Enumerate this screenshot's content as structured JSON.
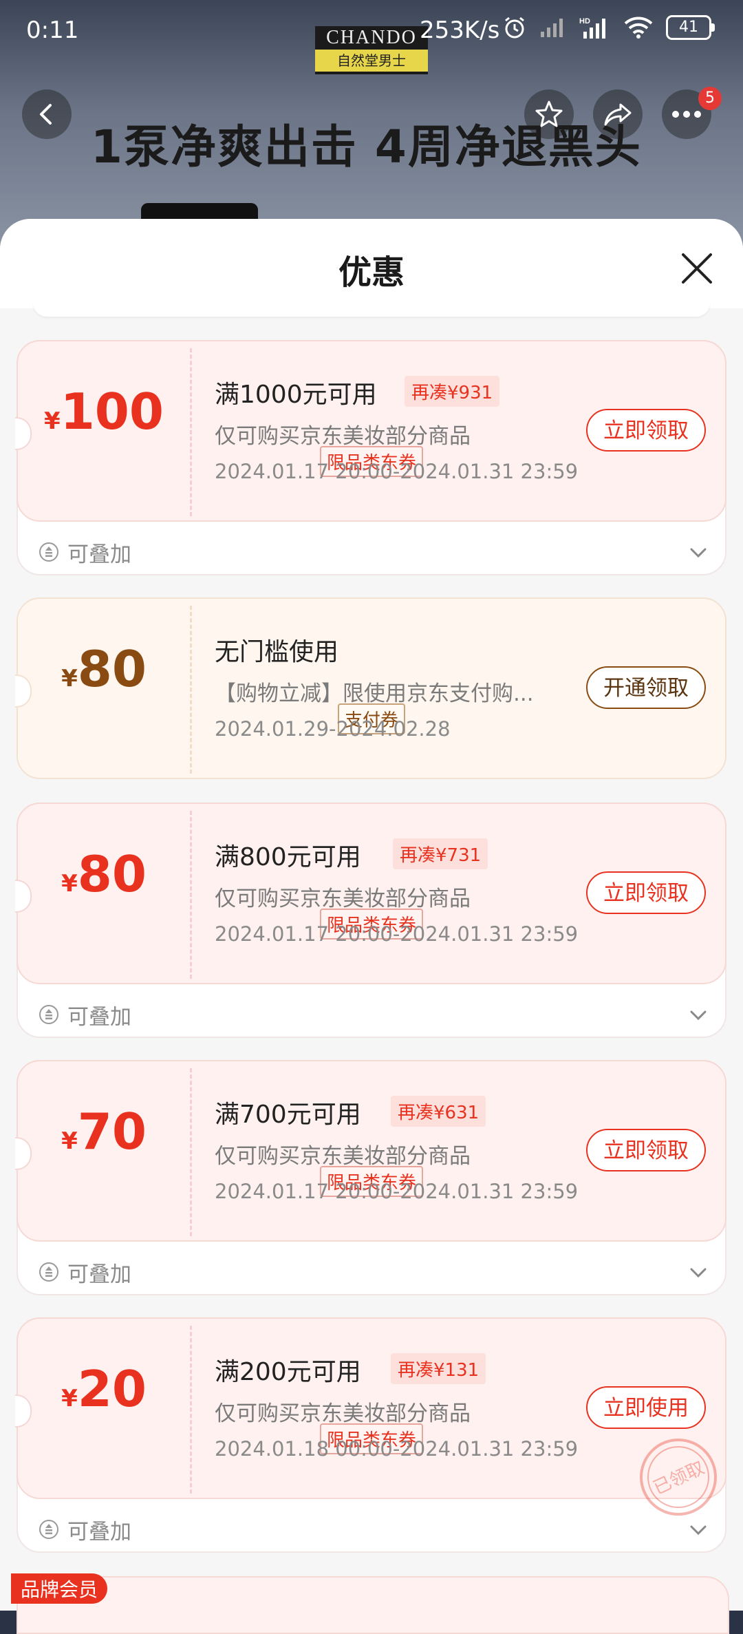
{
  "status_bar": {
    "time": "0:11",
    "network_speed": "253K/s",
    "battery": "41",
    "icons": [
      "alarm-icon",
      "signal-icon",
      "signal-hd-icon",
      "wifi-icon",
      "battery-icon"
    ]
  },
  "background_page": {
    "brand_logo_line1": "CHANDO",
    "brand_logo_line2": "自然堂男士",
    "banner_text": "1泵净爽出击 4周净退黑头",
    "cart_badge_count": "5"
  },
  "sheet": {
    "title": "优惠"
  },
  "coupons": [
    {
      "currency": "¥",
      "amount": "100",
      "type": "限品类东券",
      "condition": "满1000元可用",
      "diff": "再凑¥931",
      "desc": "仅可购买京东美妆部分商品",
      "date": "2024.01.17 20:00-2024.01.31 23:59",
      "button": "立即领取",
      "stack": "可叠加",
      "style": "red",
      "claimed": false
    },
    {
      "currency": "¥",
      "amount": "80",
      "type": "支付券",
      "condition": "无门槛使用",
      "diff": "",
      "desc": "【购物立减】限使用京东支付购...",
      "date": "2024.01.29-2024.02.28",
      "button": "开通领取",
      "stack": "",
      "style": "gold",
      "claimed": false
    },
    {
      "currency": "¥",
      "amount": "80",
      "type": "限品类东券",
      "condition": "满800元可用",
      "diff": "再凑¥731",
      "desc": "仅可购买京东美妆部分商品",
      "date": "2024.01.17 20:00-2024.01.31 23:59",
      "button": "立即领取",
      "stack": "可叠加",
      "style": "red",
      "claimed": false
    },
    {
      "currency": "¥",
      "amount": "70",
      "type": "限品类东券",
      "condition": "满700元可用",
      "diff": "再凑¥631",
      "desc": "仅可购买京东美妆部分商品",
      "date": "2024.01.17 20:00-2024.01.31 23:59",
      "button": "立即领取",
      "stack": "可叠加",
      "style": "red",
      "claimed": false
    },
    {
      "currency": "¥",
      "amount": "20",
      "type": "限品类东券",
      "condition": "满200元可用",
      "diff": "再凑¥131",
      "desc": "仅可购买京东美妆部分商品",
      "date": "2024.01.18 00:00-2024.01.31 23:59",
      "button": "立即使用",
      "stack": "可叠加",
      "style": "red",
      "claimed": true,
      "stamp_text": "已领取"
    }
  ],
  "member_tag": "品牌会员",
  "colors": {
    "accent_red": "#e8321f",
    "gold_text": "#8a4b12",
    "coupon_bg_red": "#fff1f0",
    "coupon_bg_gold": "#fff7ef"
  }
}
